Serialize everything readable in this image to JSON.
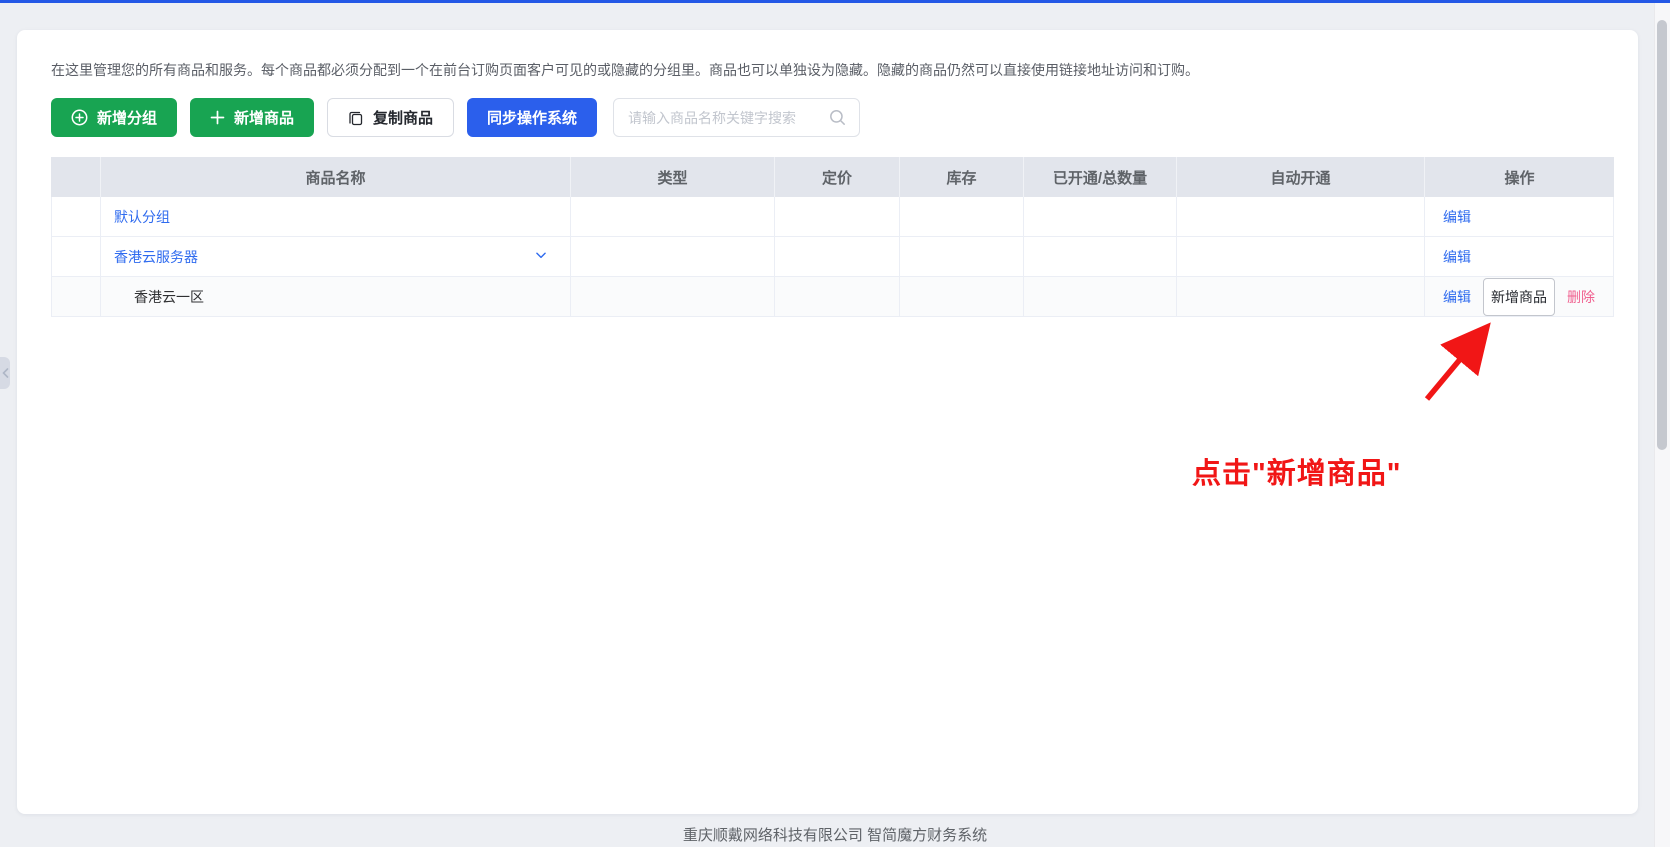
{
  "colors": {
    "topbar": "#2458e6",
    "green": "#18a452",
    "blue": "#2b5fec",
    "link": "#2f6bef",
    "danger": "#f0608f",
    "annotation": "#f11616"
  },
  "intro": "在这里管理您的所有商品和服务。每个商品都必须分配到一个在前台订购页面客户可见的或隐藏的分组里。商品也可以单独设为隐藏。隐藏的商品仍然可以直接使用链接地址访问和订购。",
  "toolbar": {
    "add_group": "新增分组",
    "add_product": "新增商品",
    "copy_product": "复制商品",
    "sync_os": "同步操作系统",
    "search_placeholder": "请输入商品名称关键字搜索"
  },
  "table": {
    "columns": [
      "",
      "商品名称",
      "类型",
      "定价",
      "库存",
      "已开通/总数量",
      "自动开通",
      "操作"
    ],
    "rows": [
      {
        "name": "默认分组",
        "edit": "编辑"
      },
      {
        "name": "香港云服务器",
        "edit": "编辑"
      },
      {
        "name": "香港云一区",
        "edit": "编辑",
        "add": "新增商品",
        "delete": "删除"
      }
    ]
  },
  "annotation": {
    "text": "点击\"新增商品\""
  },
  "footer": "重庆顺戴网络科技有限公司 智简魔方财务系统"
}
